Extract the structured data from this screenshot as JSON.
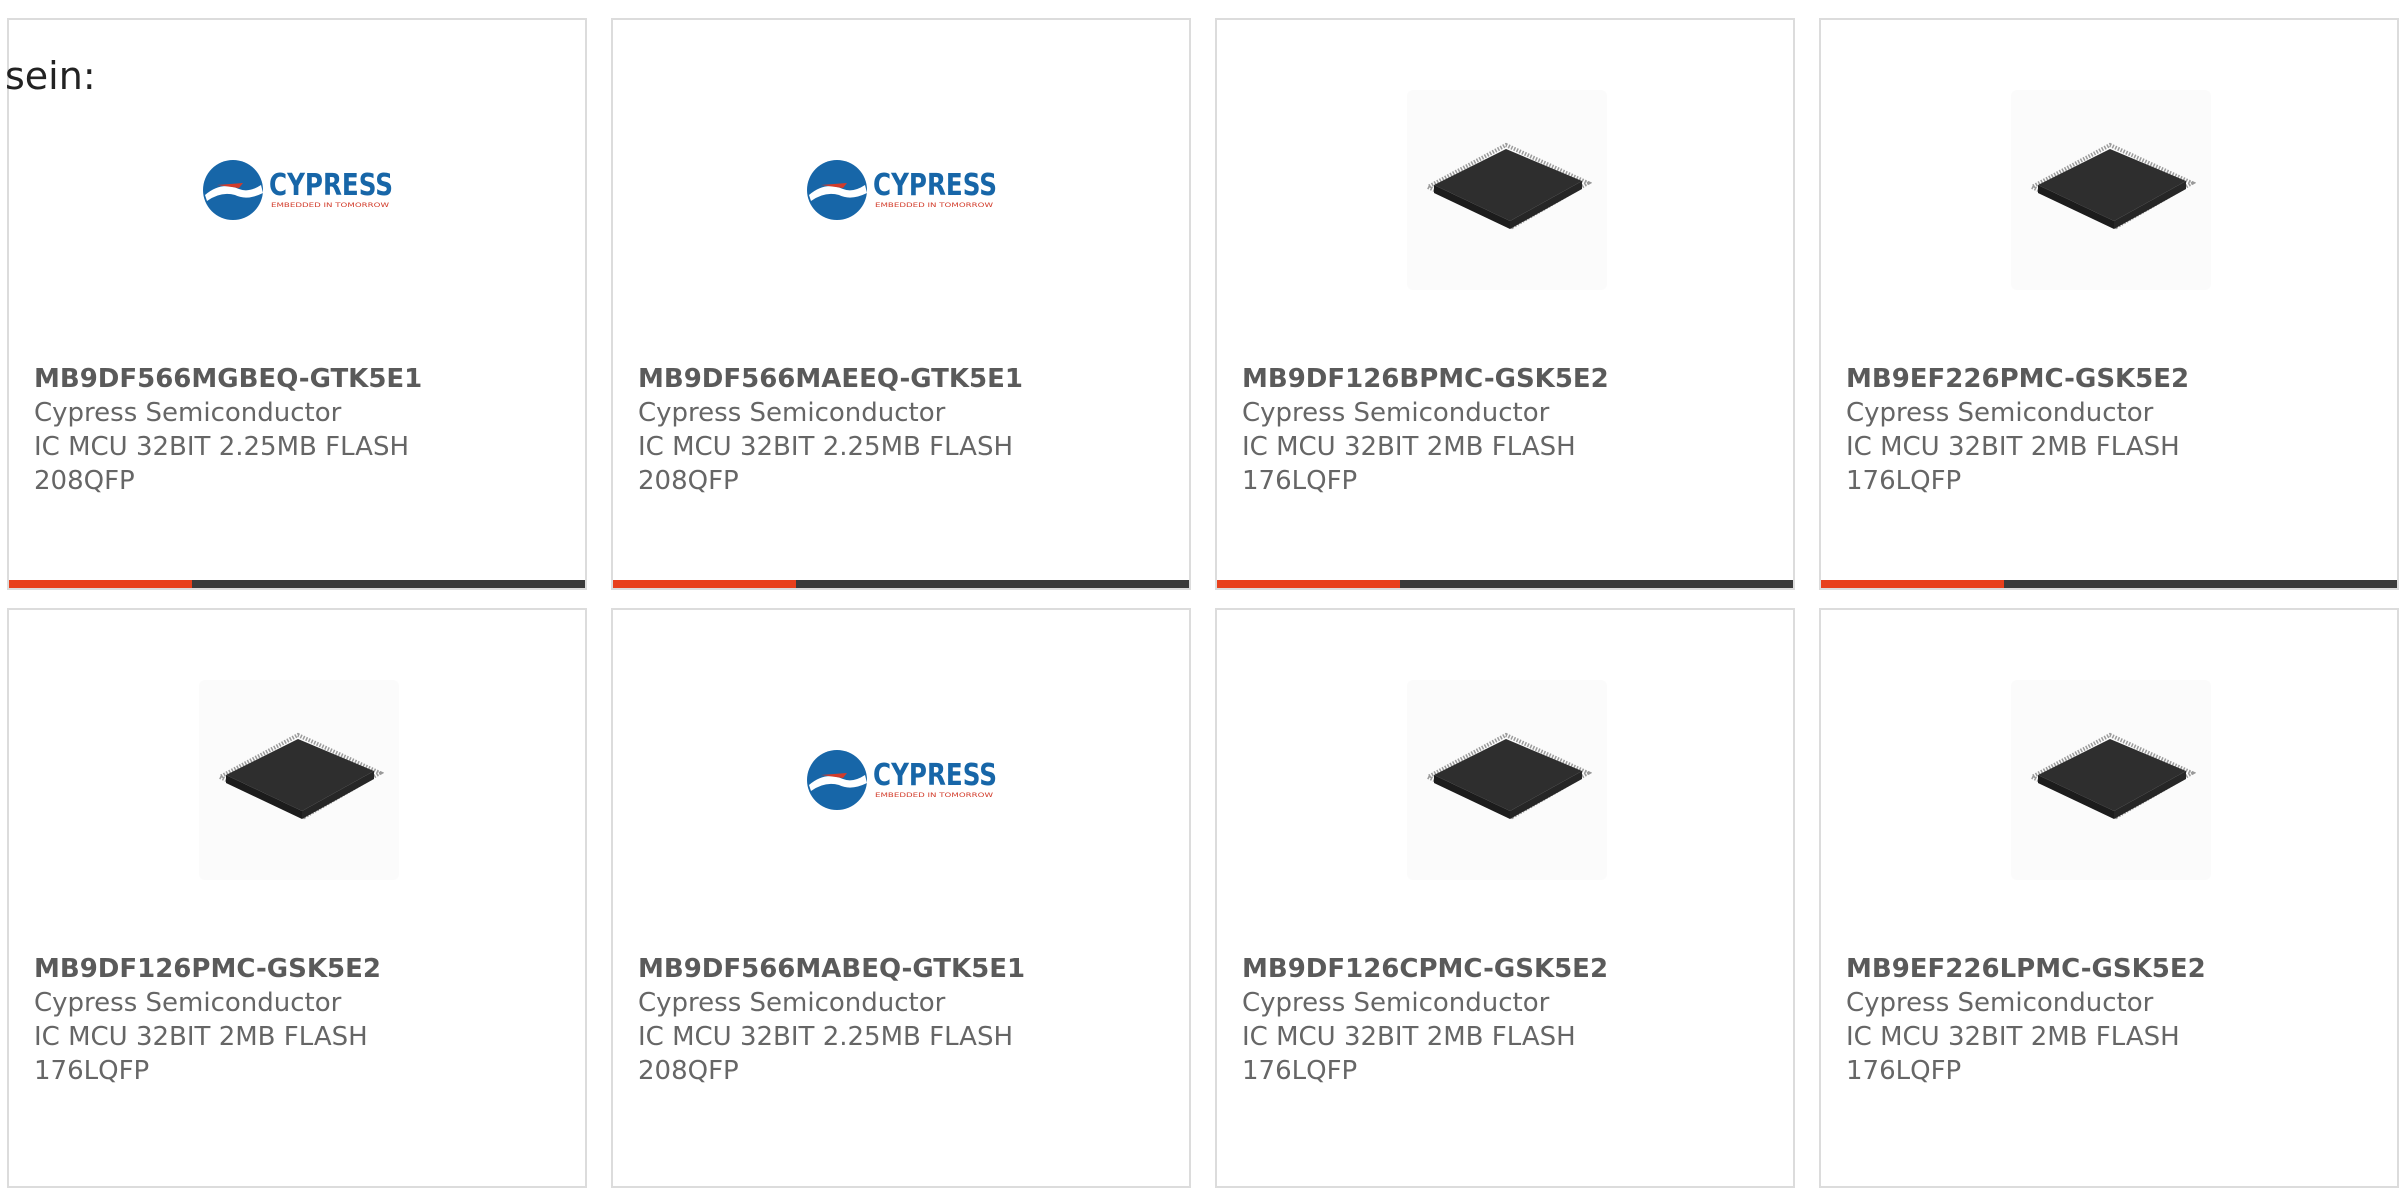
{
  "page": {
    "intro_text": "sein:"
  },
  "colors": {
    "accent": "#e8401c",
    "bar": "#3b3b3b",
    "cypress_blue": "#1766a8",
    "cypress_red": "#d23b2a",
    "chip_dark": "#2e2e2e"
  },
  "products": [
    {
      "part_number": "MB9DF566MGBEQ-GTK5E1",
      "manufacturer": "Cypress Semiconductor",
      "description": "IC MCU 32BIT 2.25MB FLASH 208QFP",
      "image": "cypress-logo",
      "logo_text": "CYPRESS",
      "logo_tagline": "EMBEDDED IN TOMORROW"
    },
    {
      "part_number": "MB9DF566MAEEQ-GTK5E1",
      "manufacturer": "Cypress Semiconductor",
      "description": "IC MCU 32BIT 2.25MB FLASH 208QFP",
      "image": "cypress-logo",
      "logo_text": "CYPRESS",
      "logo_tagline": "EMBEDDED IN TOMORROW"
    },
    {
      "part_number": "MB9DF126BPMC-GSK5E2",
      "manufacturer": "Cypress Semiconductor",
      "description": "IC MCU 32BIT 2MB FLASH 176LQFP",
      "image": "chip-photo"
    },
    {
      "part_number": "MB9EF226PMC-GSK5E2",
      "manufacturer": "Cypress Semiconductor",
      "description": "IC MCU 32BIT 2MB FLASH 176LQFP",
      "image": "chip-photo"
    },
    {
      "part_number": "MB9DF126PMC-GSK5E2",
      "manufacturer": "Cypress Semiconductor",
      "description": "IC MCU 32BIT 2MB FLASH 176LQFP",
      "image": "chip-photo"
    },
    {
      "part_number": "MB9DF566MABEQ-GTK5E1",
      "manufacturer": "Cypress Semiconductor",
      "description": "IC MCU 32BIT 2.25MB FLASH 208QFP",
      "image": "cypress-logo",
      "logo_text": "CYPRESS",
      "logo_tagline": "EMBEDDED IN TOMORROW"
    },
    {
      "part_number": "MB9DF126CPMC-GSK5E2",
      "manufacturer": "Cypress Semiconductor",
      "description": "IC MCU 32BIT 2MB FLASH 176LQFP",
      "image": "chip-photo"
    },
    {
      "part_number": "MB9EF226LPMC-GSK5E2",
      "manufacturer": "Cypress Semiconductor",
      "description": "IC MCU 32BIT 2MB FLASH 176LQFP",
      "image": "chip-photo"
    }
  ]
}
